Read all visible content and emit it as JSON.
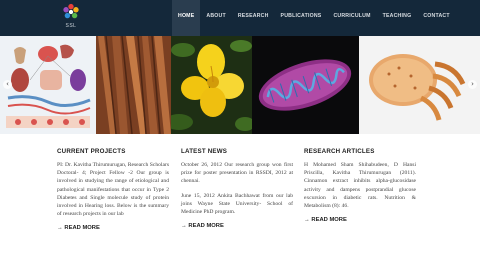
{
  "logo": {
    "text": "SSL",
    "icon": "flower-logo-icon"
  },
  "nav": {
    "items": [
      {
        "label": "HOME",
        "active": true
      },
      {
        "label": "ABOUT",
        "active": false
      },
      {
        "label": "RESEARCH",
        "active": false
      },
      {
        "label": "PUBLICATIONS",
        "active": false
      },
      {
        "label": "CURRICULUM",
        "active": false
      },
      {
        "label": "TEACHING",
        "active": false
      },
      {
        "label": "CONTACT",
        "active": false
      }
    ]
  },
  "banner": {
    "images": [
      "organs-diagram-image",
      "cinnamon-bark-image",
      "yellow-flower-image",
      "mitochondrion-image",
      "cell-organelle-image"
    ],
    "prev_icon": "chevron-left-icon",
    "next_icon": "chevron-right-icon"
  },
  "current_projects": {
    "title": "CURRENT PROJECTS",
    "text": "PI: Dr. Kavitha Thirumurugan, Research Scholars Doctoral- 4; Project Fellow -2 Our group is involved in studying the range of etiological and pathological manifestations that occur in Type 2 Diabetes and Single molecule study of protein involved in Hearing loss. Below is the summary of research projects in our lab",
    "read_more": "→ READ MORE"
  },
  "latest_news": {
    "title": "LATEST NEWS",
    "items": [
      "October 26, 2012 Our research group won first prize for poster presentation in RSSDI, 2012 at chennai.",
      "June 15, 2012 Ankita Bachhawat from our lab joins Wayne State University- School of Medicine PhD program."
    ],
    "read_more": "→ READ MORE"
  },
  "research_articles": {
    "title": "RESEARCH ARTICLES",
    "text": "H Mohamed Sham Shihabudeen, D Hansi Priscilla, Kavitha Thirumurugan (2011). Cinnamon extract inhibits alpha-glucosidase activity and dampens postprandial glucose excursion in diabetic rats. Nutrition & Metabolism (8): 46.",
    "read_more": "→ READ MORE"
  },
  "colors": {
    "header_bg": "#14283a",
    "nav_active_bg": "#2a3d4f"
  }
}
